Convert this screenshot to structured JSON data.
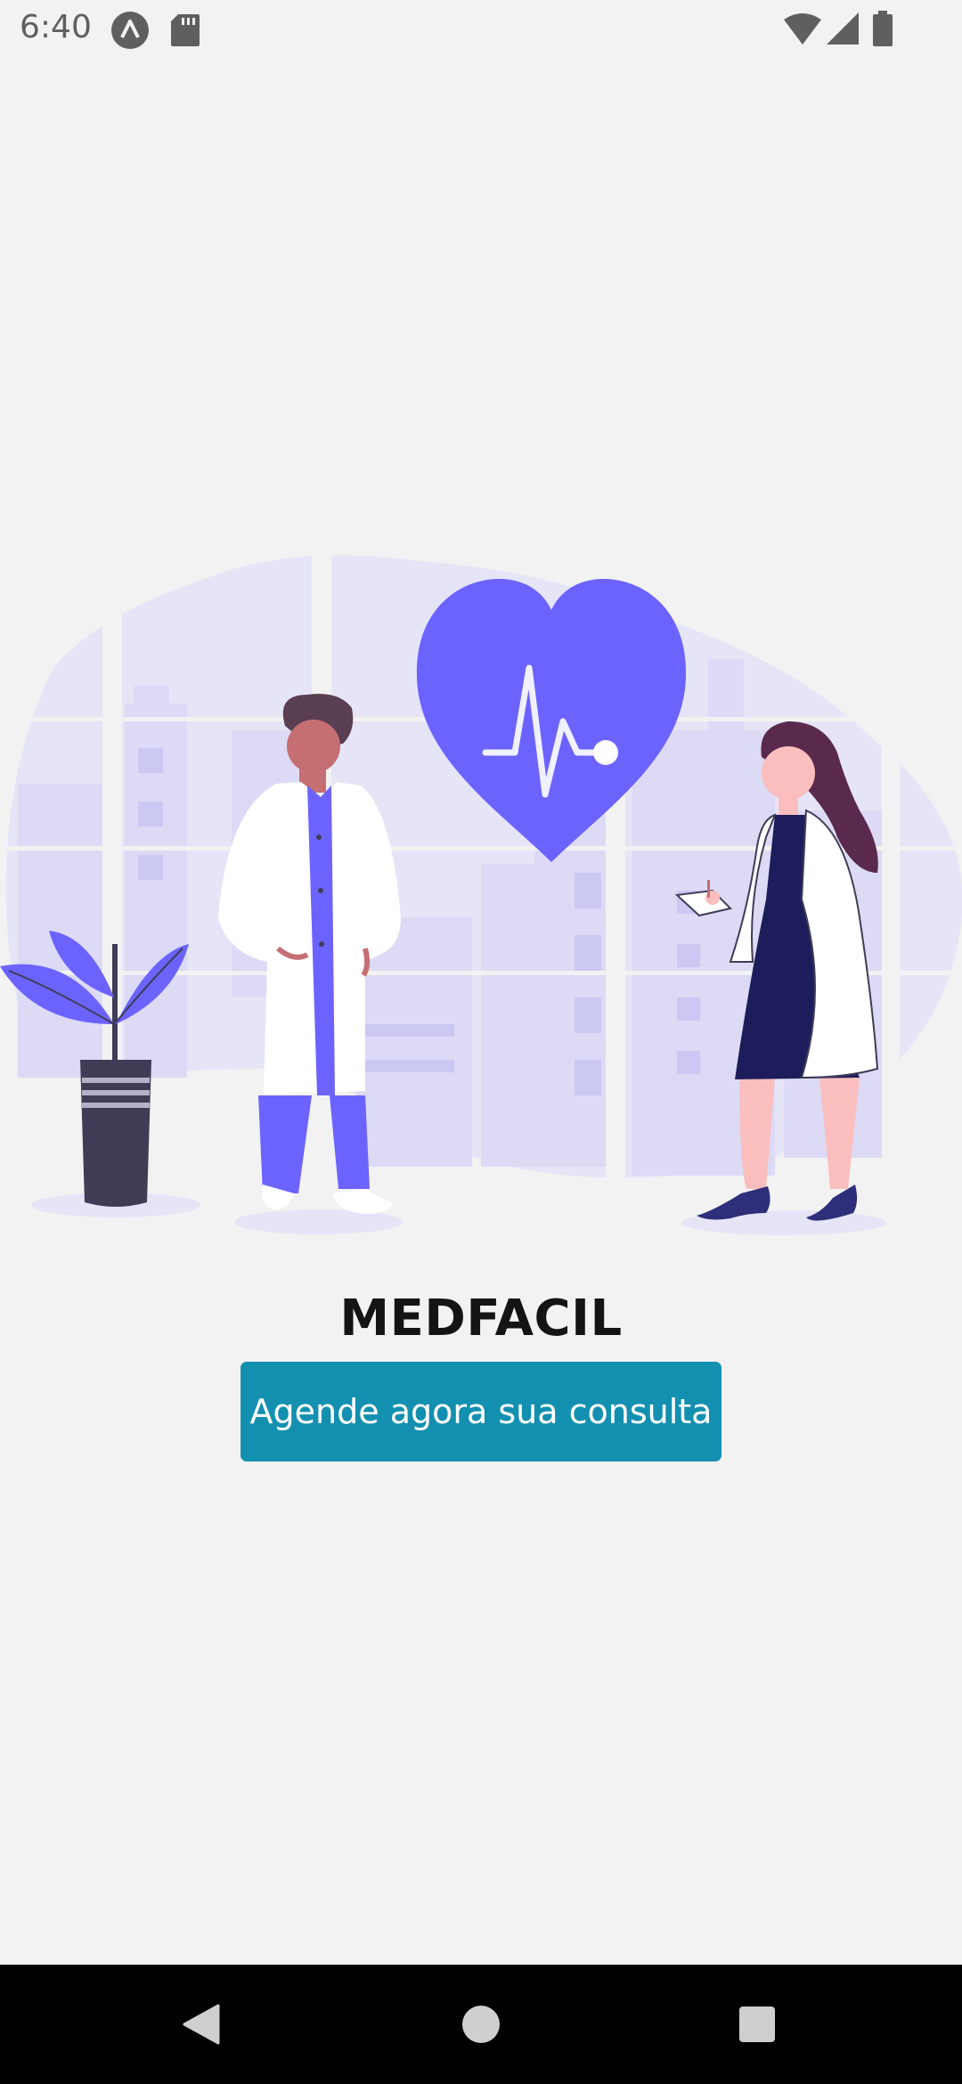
{
  "status_bar": {
    "time": "6:40",
    "icons": [
      "app-notification-icon",
      "sd-card-icon",
      "wifi-icon",
      "cell-signal-icon",
      "battery-icon"
    ]
  },
  "hero": {
    "illustration": "doctors-illustration",
    "colors": {
      "accent": "#6c63ff",
      "background_shape": "#e6e5f7",
      "buildings": "#dcdaf5"
    }
  },
  "app": {
    "title": "MEDFACIL",
    "cta_label": "Agende agora sua consulta"
  },
  "colors": {
    "background": "#f2f2f2",
    "button": "#1390b0",
    "button_text": "#ffffff",
    "title": "#141414"
  },
  "nav_bar": {
    "icons": [
      "back-icon",
      "home-icon",
      "recents-icon"
    ]
  }
}
